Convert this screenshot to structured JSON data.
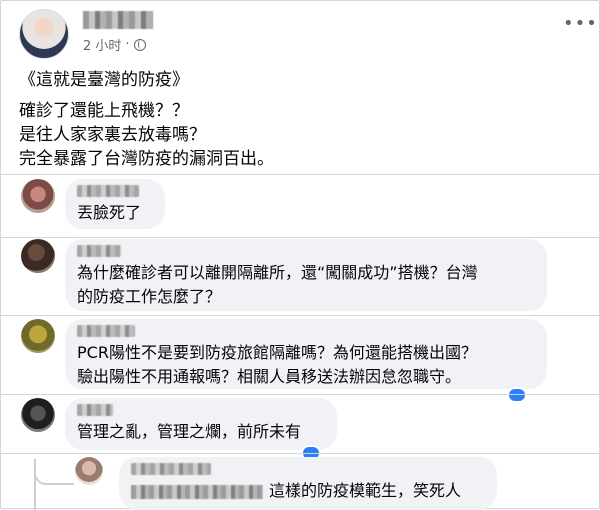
{
  "post": {
    "author": "",
    "timestamp": "2 小时",
    "separator_dot": "·",
    "privacy_icon": "globe-icon",
    "more_icon": "more-options-icon",
    "title": "《這就是臺灣的防疫》",
    "body_lines": [
      "確診了還能上飛機？？",
      "是往人家家裏去放毒嗎？",
      "完全暴露了台灣防疫的漏洞百出。"
    ]
  },
  "comments": [
    {
      "author": "",
      "text_lines": [
        "丟臉死了"
      ]
    },
    {
      "author": "",
      "text_lines": [
        "為什麼確診者可以離開隔離所，還“闖關成功”搭機？台灣",
        "的防疫工作怎麼了？"
      ]
    },
    {
      "author": "",
      "text_lines": [
        "PCR陽性不是要到防疫旅館隔離嗎？為何還能搭機出國？",
        "驗出陽性不用通報嗎？相關人員移送法辦因怠忽職守。"
      ]
    },
    {
      "author": "",
      "text_lines": [
        "管理之亂，管理之爛，前所未有"
      ]
    }
  ],
  "reply": {
    "author": "",
    "text": "這樣的防疫模範生，笑死人"
  },
  "colors": {
    "reaction": "#2d7ff9",
    "bubble": "#f0f2f5",
    "meta": "#65676b"
  }
}
